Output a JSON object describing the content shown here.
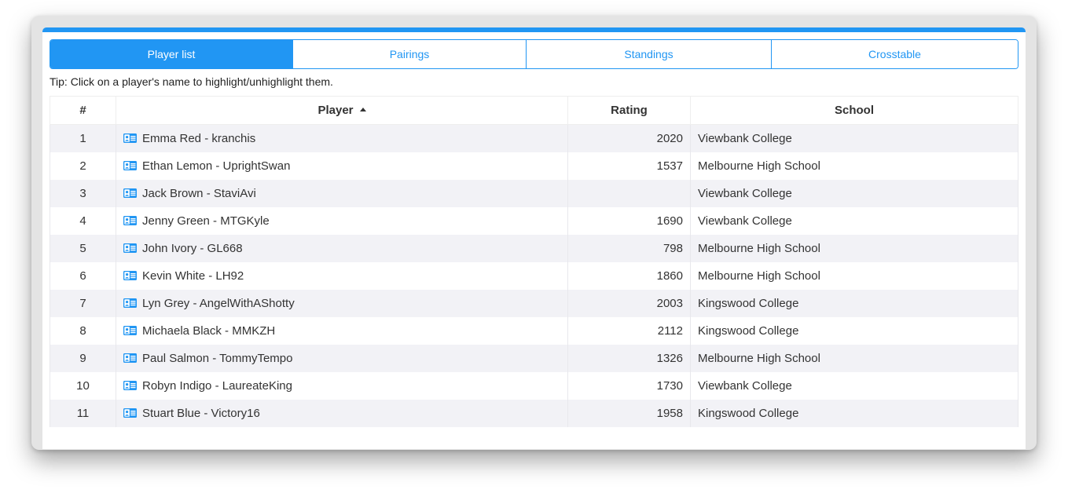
{
  "tabs": [
    {
      "label": "Player list",
      "active": true
    },
    {
      "label": "Pairings",
      "active": false
    },
    {
      "label": "Standings",
      "active": false
    },
    {
      "label": "Crosstable",
      "active": false
    }
  ],
  "tip": "Tip: Click on a player's name to highlight/unhighlight them.",
  "table": {
    "headers": {
      "num": "#",
      "player": "Player",
      "rating": "Rating",
      "school": "School"
    },
    "sort": {
      "column": "Player",
      "direction": "ascending"
    },
    "rows": [
      {
        "num": "1",
        "player": "Emma Red - kranchis",
        "rating": "2020",
        "school": "Viewbank College"
      },
      {
        "num": "2",
        "player": "Ethan Lemon - UprightSwan",
        "rating": "1537",
        "school": "Melbourne High School"
      },
      {
        "num": "3",
        "player": "Jack Brown - StaviAvi",
        "rating": "",
        "school": "Viewbank College"
      },
      {
        "num": "4",
        "player": "Jenny Green - MTGKyle",
        "rating": "1690",
        "school": "Viewbank College"
      },
      {
        "num": "5",
        "player": "John Ivory - GL668",
        "rating": "798",
        "school": "Melbourne High School"
      },
      {
        "num": "6",
        "player": "Kevin White - LH92",
        "rating": "1860",
        "school": "Melbourne High School"
      },
      {
        "num": "7",
        "player": "Lyn Grey - AngelWithAShotty",
        "rating": "2003",
        "school": "Kingswood College"
      },
      {
        "num": "8",
        "player": "Michaela Black - MMKZH",
        "rating": "2112",
        "school": "Kingswood College"
      },
      {
        "num": "9",
        "player": "Paul Salmon - TommyTempo",
        "rating": "1326",
        "school": "Melbourne High School"
      },
      {
        "num": "10",
        "player": "Robyn Indigo - LaureateKing",
        "rating": "1730",
        "school": "Viewbank College"
      },
      {
        "num": "11",
        "player": "Stuart Blue - Victory16",
        "rating": "1958",
        "school": "Kingswood College"
      }
    ]
  },
  "colors": {
    "accent": "#2196f3",
    "row_stripe": "#f2f2f6"
  },
  "icons": {
    "player_card": "id-card-icon",
    "sort": "sort-ascending-icon"
  }
}
